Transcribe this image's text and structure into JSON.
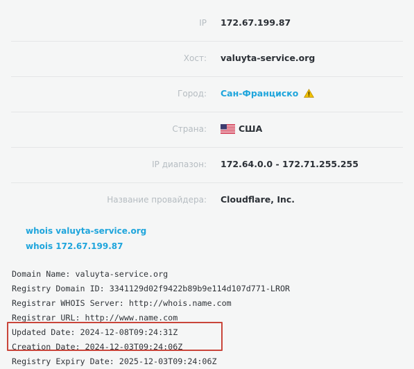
{
  "info": {
    "ip": {
      "label": "IP",
      "value": "172.67.199.87"
    },
    "host": {
      "label": "Хост:",
      "value": "valuyta-service.org"
    },
    "city": {
      "label": "Город:",
      "value": "Сан-Франциско",
      "icon": "warning-icon"
    },
    "country": {
      "label": "Страна:",
      "value": "США",
      "icon": "us-flag-icon"
    },
    "range": {
      "label": "IP диапазон:",
      "value": "172.64.0.0 - 172.71.255.255"
    },
    "provider": {
      "label": "Название провайдера:",
      "value": "Cloudflare, Inc."
    }
  },
  "whois_links": [
    "whois valuyta-service.org",
    "whois 172.67.199.87"
  ],
  "raw_whois": [
    "Domain Name: valuyta-service.org",
    "Registry Domain ID: 3341129d02f9422b89b9e114d107d771-LROR",
    "Registrar WHOIS Server: http://whois.name.com",
    "Registrar URL: http://www.name.com",
    "Updated Date: 2024-12-08T09:24:31Z",
    "Creation Date: 2024-12-03T09:24:06Z",
    "Registry Expiry Date: 2025-12-03T09:24:06Z"
  ],
  "colors": {
    "link": "#1fa5dc",
    "highlight": "#c9453a",
    "warning": "#f2c200"
  }
}
